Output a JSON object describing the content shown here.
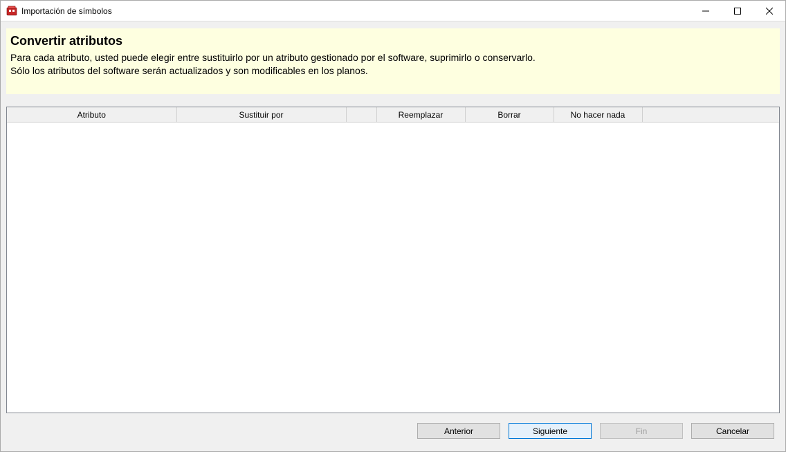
{
  "window": {
    "title": "Importación de símbolos"
  },
  "info": {
    "heading": "Convertir atributos",
    "line1": "Para cada atributo, usted puede elegir entre sustituirlo por un atributo gestionado por el software, suprimirlo o conservarlo.",
    "line2": "Sólo los atributos del software serán actualizados y son modificables en los planos."
  },
  "table": {
    "headers": {
      "attr": "Atributo",
      "substitute": "Sustituir por",
      "narrow": "",
      "replace": "Reemplazar",
      "delete": "Borrar",
      "nothing": "No hacer nada",
      "rest": ""
    }
  },
  "buttons": {
    "prev": "Anterior",
    "next": "Siguiente",
    "finish": "Fin",
    "cancel": "Cancelar"
  }
}
